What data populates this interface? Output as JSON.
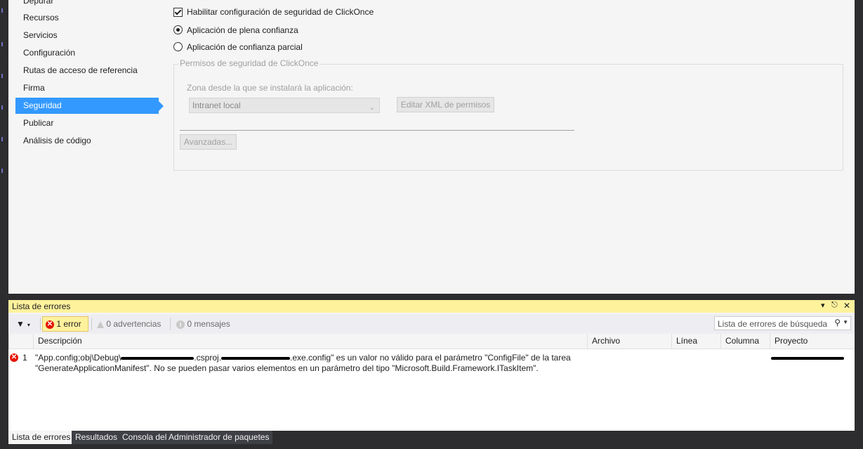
{
  "nav": {
    "items": [
      {
        "label": "Depurar"
      },
      {
        "label": "Recursos"
      },
      {
        "label": "Servicios"
      },
      {
        "label": "Configuración"
      },
      {
        "label": "Rutas de acceso de referencia"
      },
      {
        "label": "Firma"
      },
      {
        "label": "Seguridad"
      },
      {
        "label": "Publicar"
      },
      {
        "label": "Análisis de código"
      }
    ],
    "active": "Seguridad"
  },
  "security": {
    "enable_label": "Habilitar configuración de seguridad de ClickOnce",
    "enable_checked": true,
    "full_trust_label": "Aplicación de plena confianza",
    "partial_trust_label": "Aplicación de confianza parcial",
    "selected_trust": "full",
    "group_title": "Permisos de seguridad de ClickOnce",
    "zone_label": "Zona desde la que se instalará la aplicación:",
    "zone_value": "Intranet local",
    "edit_xml_label": "Editar XML de permisos",
    "advanced_label": "Avanzadas..."
  },
  "error_list": {
    "title": "Lista de errores",
    "errors_label": "1 error",
    "warnings_label": "0 advertencias",
    "messages_label": "0 mensajes",
    "search_placeholder": "Lista de errores de búsqueda",
    "columns": {
      "description": "Descripción",
      "file": "Archivo",
      "line": "Línea",
      "column": "Columna",
      "project": "Proyecto"
    },
    "rows": [
      {
        "number": "1",
        "desc_part1": "\"App.config;obj\\Debug\\",
        "desc_part2": ".csproj.",
        "desc_part3": ".exe.config\" es un valor no válido para el parámetro \"ConfigFile\" de la tarea",
        "desc_line2": "\"GenerateApplicationManifest\". No se pueden pasar varios elementos en un parámetro del tipo \"Microsoft.Build.Framework.ITaskItem\"."
      }
    ]
  },
  "bottom_tabs": {
    "error_list": "Lista de errores",
    "results": "Resultados",
    "package_console": "Consola del Administrador de paquetes"
  },
  "colors": {
    "accent": "#3399ff",
    "error": "#e51400",
    "tool_window_title": "#fff29d",
    "chrome": "#2d2d30"
  }
}
